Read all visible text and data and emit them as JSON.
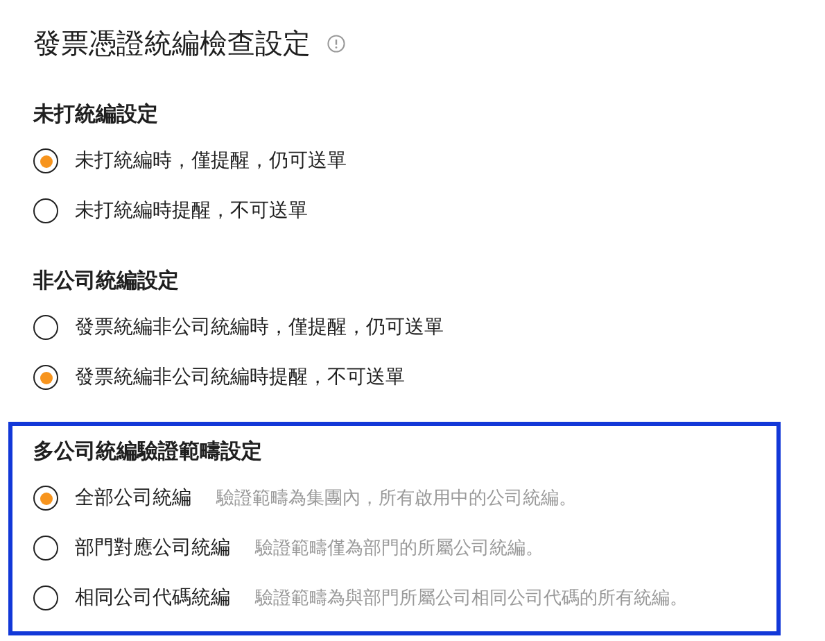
{
  "title": "發票憑證統編檢查設定",
  "sections": [
    {
      "heading": "未打統編設定",
      "highlighted": false,
      "options": [
        {
          "label": "未打統編時，僅提醒，仍可送單",
          "selected": true
        },
        {
          "label": "未打統編時提醒，不可送單",
          "selected": false
        }
      ]
    },
    {
      "heading": "非公司統編設定",
      "highlighted": false,
      "options": [
        {
          "label": "發票統編非公司統編時，僅提醒，仍可送單",
          "selected": false
        },
        {
          "label": "發票統編非公司統編時提醒，不可送單",
          "selected": true
        }
      ]
    },
    {
      "heading": "多公司統編驗證範疇設定",
      "highlighted": true,
      "options": [
        {
          "label": "全部公司統編",
          "description": "驗證範疇為集團內，所有啟用中的公司統編。",
          "selected": true
        },
        {
          "label": "部門對應公司統編",
          "description": "驗證範疇僅為部門的所屬公司統編。",
          "selected": false
        },
        {
          "label": "相同公司代碼統編",
          "description": "驗證範疇為與部門所屬公司相同公司代碼的所有統編。",
          "selected": false
        }
      ]
    }
  ]
}
